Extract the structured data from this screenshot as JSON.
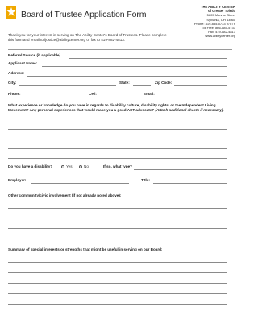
{
  "header": {
    "title": "Board of Trustee Application Form",
    "org_name": "THE ABILITY CENTER",
    "org_subname": "of Greater Toledo",
    "address1": "5605 Monroe Street",
    "address2": "Sylvania, OH 43560",
    "phone": "Phone: 419-885-5733 V/TTY",
    "tollfree": "Toll Free: 866-885-5733",
    "fax": "Fax: 419-882-4813",
    "web": "www.abilitycenter.org"
  },
  "intro": {
    "text": "Thank you for your interest in serving on The Ability Center's Board of Trustees. Please complete this form and email to ljustice@abilitycenter.org or fax to 419-882-4813."
  },
  "fields": {
    "referral": "Referral Source (if applicable)",
    "applicant": "Applicant Name:",
    "address": "Address:",
    "city": "City:",
    "state": "State:",
    "zip": "Zip Code:",
    "phone": "Phone:",
    "cell": "Cell:",
    "email": "Email:"
  },
  "experience": {
    "question": "What experience or knowledge do you have in regards to disability culture, disability rights, or the Independent Living Movement? Any personal experiences that would make you a good ACT advocate?",
    "note": "(Attach additional sheets if necessary)."
  },
  "disability": {
    "question": "Do you have a disability?",
    "yes": "Yes",
    "no": "No",
    "what_type": "If so, what type?"
  },
  "employment": {
    "employer": "Employer:",
    "title": "Title:"
  },
  "civic": {
    "question": "Other community/civic involvement (if not already noted above):"
  },
  "summary": {
    "question": "Summary of special interests or strengths that might be useful in serving on our Board:"
  }
}
